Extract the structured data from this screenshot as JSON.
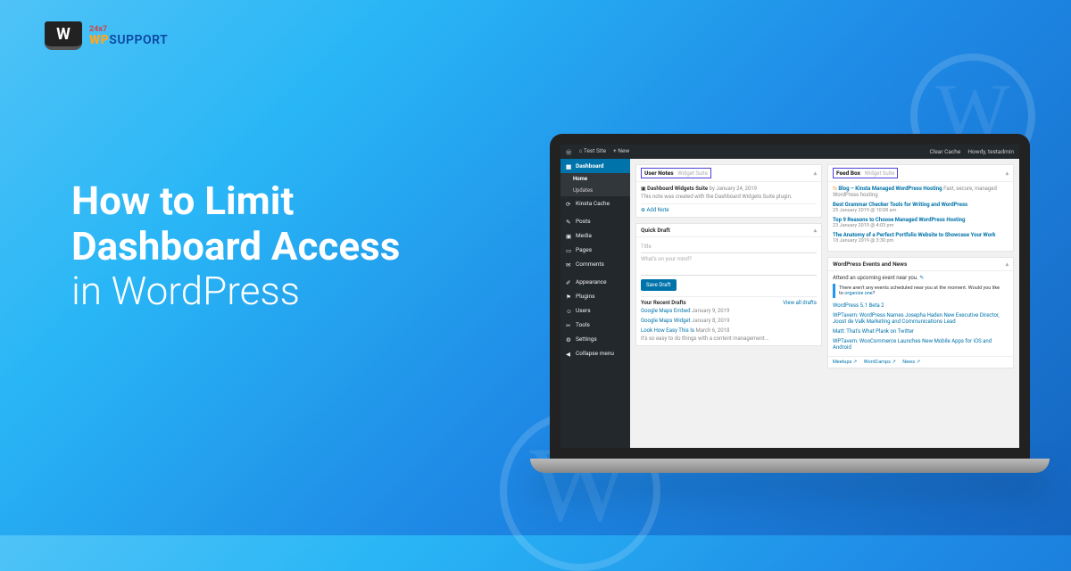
{
  "logo": {
    "mark_text": "W",
    "tag_247": "24x7",
    "brand_wp": "WP",
    "brand_support": "SUPPORT"
  },
  "heading": {
    "line1": "How to Limit",
    "line2": "Dashboard Access",
    "line3": "in WordPress"
  },
  "adminbar": {
    "site": "Test Site",
    "new": "+ New",
    "clear_cache": "Clear Cache",
    "howdy": "Howdy, testadmin"
  },
  "menu": {
    "dashboard": "Dashboard",
    "home": "Home",
    "updates": "Updates",
    "kinsta_cache": "Kinsta Cache",
    "posts": "Posts",
    "media": "Media",
    "pages": "Pages",
    "comments": "Comments",
    "appearance": "Appearance",
    "plugins": "Plugins",
    "users": "Users",
    "tools": "Tools",
    "settings": "Settings",
    "collapse": "Collapse menu"
  },
  "user_notes": {
    "title": "User Notes",
    "subtitle": "Widget Suite",
    "widget_by": "Dashboard Widgets Suite",
    "widget_by_meta": "by January 24, 2019",
    "note_text": "This note was created with the Dashboard Widgets Suite plugin.",
    "add_note": "Add Note"
  },
  "quick_draft": {
    "title": "Quick Draft",
    "title_ph": "Title",
    "content_ph": "What's on your mind?",
    "save": "Save Draft",
    "recent_drafts": "Your Recent Drafts",
    "view_all": "View all drafts",
    "drafts": [
      {
        "t": "Google Maps Embed",
        "d": "January 9, 2019"
      },
      {
        "t": "Google Maps Widget",
        "d": "January 8, 2019"
      },
      {
        "t": "Look How Easy This Is",
        "d": "March 6, 2018"
      }
    ],
    "excerpt": "It's so easy to do things with a content management..."
  },
  "feed_box": {
    "title": "Feed Box",
    "subtitle": "Widget Suite",
    "items": [
      {
        "t": "Blog – Kinsta Managed WordPress Hosting",
        "m": "Fast, secure, managed WordPress hosting"
      },
      {
        "t": "Best Grammar Checker Tools for Writing and WordPress",
        "d": "25 January 2019 @ 10:08 am"
      },
      {
        "t": "Top 9 Reasons to Choose Managed WordPress Hosting",
        "d": "23 January 2019 @ 4:03 pm"
      },
      {
        "t": "The Anatomy of a Perfect Portfolio Website to Showcase Your Work",
        "d": "18 January 2019 @ 3:30 pm"
      }
    ]
  },
  "events": {
    "title": "WordPress Events and News",
    "attend": "Attend an upcoming event near you.",
    "no_events_1": "There aren't any events scheduled near you at the moment. Would you like to ",
    "no_events_link": "organize one",
    "no_events_2": "?",
    "news": [
      "WordPress 5.1 Beta 2",
      "WPTavern: WordPress Names Josepha Haden New Executive Director, Joost de Valk Marketing and Communications Lead",
      "Matt: That's What Plank on Twitter",
      "WPTavern: WooCommerce Launches New Mobile Apps for iOS and Android"
    ],
    "footer": [
      "Meetups",
      "WordCamps",
      "News"
    ]
  }
}
